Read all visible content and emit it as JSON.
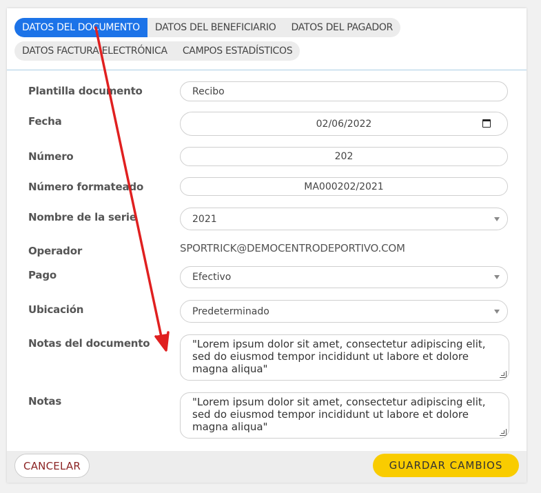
{
  "tabs": {
    "row1": [
      "DATOS DEL DOCUMENTO",
      "DATOS DEL BENEFICIARIO",
      "DATOS DEL PAGADOR"
    ],
    "row2": [
      "DATOS FACTURA ELECTRÓNICA",
      "CAMPOS ESTADÍSTICOS"
    ],
    "active": "DATOS DEL DOCUMENTO"
  },
  "form": {
    "plantilla": {
      "label": "Plantilla documento",
      "value": "Recibo"
    },
    "fecha": {
      "label": "Fecha",
      "value": "02/06/2022",
      "icon": "calendar-icon"
    },
    "numero": {
      "label": "Número",
      "value": "202"
    },
    "numero_formateado": {
      "label": "Número formateado",
      "value": "MA000202/2021"
    },
    "serie": {
      "label": "Nombre de la serie",
      "value": "2021"
    },
    "operador": {
      "label": "Operador",
      "value": "SPORTRICK@DEMOCENTRODEPORTIVO.COM"
    },
    "pago": {
      "label": "Pago",
      "value": "Efectivo"
    },
    "ubicacion": {
      "label": "Ubicación",
      "value": "Predeterminado"
    },
    "notas_documento": {
      "label": "Notas del documento",
      "value": "\"Lorem ipsum dolor sit amet, consectetur adipiscing elit, sed do eiusmod tempor incididunt ut labore et dolore magna aliqua\""
    },
    "notas": {
      "label": "Notas",
      "value": "\"Lorem ipsum dolor sit amet, consectetur adipiscing elit, sed do eiusmod tempor incididunt ut labore et dolore magna aliqua\""
    }
  },
  "footer": {
    "cancel_label": "CANCELAR",
    "save_label": "GUARDAR CAMBIOS"
  },
  "colors": {
    "active_tab": "#1c73e8",
    "save_button": "#f9cc00",
    "cancel_text": "#8b2323",
    "annotation_arrow": "#e02020"
  }
}
